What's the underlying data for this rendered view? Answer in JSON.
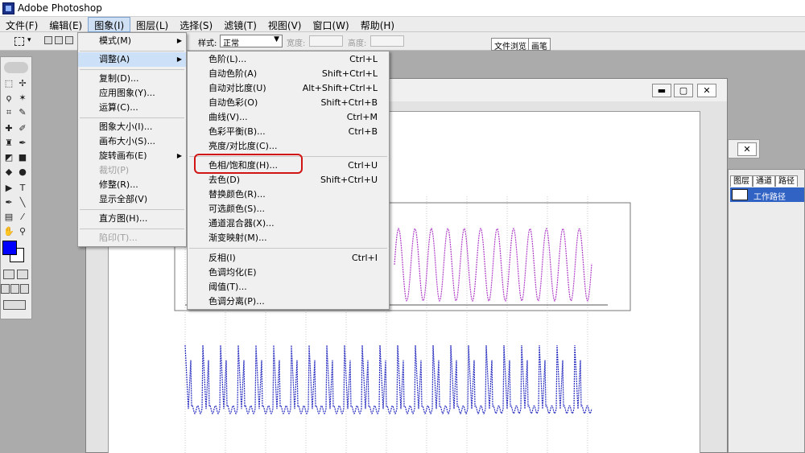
{
  "app": {
    "title": "Adobe Photoshop"
  },
  "menubar": [
    {
      "label": "文件(F)"
    },
    {
      "label": "编辑(E)"
    },
    {
      "label": "图象(I)"
    },
    {
      "label": "图层(L)"
    },
    {
      "label": "选择(S)"
    },
    {
      "label": "滤镜(T)"
    },
    {
      "label": "视图(V)"
    },
    {
      "label": "窗口(W)"
    },
    {
      "label": "帮助(H)"
    }
  ],
  "options": {
    "style_label": "样式:",
    "style_value": "正常",
    "width_label": "宽度:",
    "height_label": "高度:"
  },
  "palette_well": {
    "tab1": "文件浏览",
    "tab2": "画笔"
  },
  "image_menu": {
    "items": [
      {
        "label": "模式(M)",
        "submenu": true,
        "disabled": false
      },
      {
        "label": "调整(A)",
        "submenu": true,
        "disabled": false,
        "highlighted": true
      },
      {
        "label": "复制(D)...",
        "submenu": false,
        "disabled": false
      },
      {
        "label": "应用图象(Y)...",
        "submenu": false,
        "disabled": false
      },
      {
        "label": "运算(C)...",
        "submenu": false,
        "disabled": false
      },
      {
        "label": "图象大小(I)...",
        "submenu": false,
        "disabled": false
      },
      {
        "label": "画布大小(S)...",
        "submenu": false,
        "disabled": false
      },
      {
        "label": "旋转画布(E)",
        "submenu": true,
        "disabled": false
      },
      {
        "label": "裁切(P)",
        "submenu": false,
        "disabled": true
      },
      {
        "label": "修整(R)...",
        "submenu": false,
        "disabled": false
      },
      {
        "label": "显示全部(V)",
        "submenu": false,
        "disabled": false
      },
      {
        "label": "直方图(H)...",
        "submenu": false,
        "disabled": false
      },
      {
        "label": "陷印(T)...",
        "submenu": false,
        "disabled": true
      }
    ]
  },
  "adjust_menu": {
    "items": [
      {
        "label": "色阶(L)...",
        "shortcut": "Ctrl+L"
      },
      {
        "label": "自动色阶(A)",
        "shortcut": "Shift+Ctrl+L"
      },
      {
        "label": "自动对比度(U)",
        "shortcut": "Alt+Shift+Ctrl+L"
      },
      {
        "label": "自动色彩(O)",
        "shortcut": "Shift+Ctrl+B"
      },
      {
        "label": "曲线(V)...",
        "shortcut": "Ctrl+M"
      },
      {
        "label": "色彩平衡(B)...",
        "shortcut": "Ctrl+B"
      },
      {
        "label": "亮度/对比度(C)...",
        "shortcut": ""
      },
      {
        "label": "色相/饱和度(H)...",
        "shortcut": "Ctrl+U",
        "emphasized": true
      },
      {
        "label": "去色(D)",
        "shortcut": "Shift+Ctrl+U"
      },
      {
        "label": "替换颜色(R)...",
        "shortcut": ""
      },
      {
        "label": "可选颜色(S)...",
        "shortcut": ""
      },
      {
        "label": "通道混合器(X)...",
        "shortcut": ""
      },
      {
        "label": "渐变映射(M)...",
        "shortcut": ""
      },
      {
        "label": "反相(I)",
        "shortcut": "Ctrl+I"
      },
      {
        "label": "色调均化(E)",
        "shortcut": ""
      },
      {
        "label": "阈值(T)...",
        "shortcut": ""
      },
      {
        "label": "色调分离(P)...",
        "shortcut": ""
      }
    ]
  },
  "layers_panel": {
    "tabs": [
      "图层",
      "通道",
      "路径"
    ],
    "active_row": "工作路径"
  },
  "colors": {
    "foreground": "#0000ff",
    "background": "#ffffff",
    "magenta_wave": "#b040c8",
    "blue_wave": "#2a2fc0",
    "highlight_box": "#d11414"
  }
}
